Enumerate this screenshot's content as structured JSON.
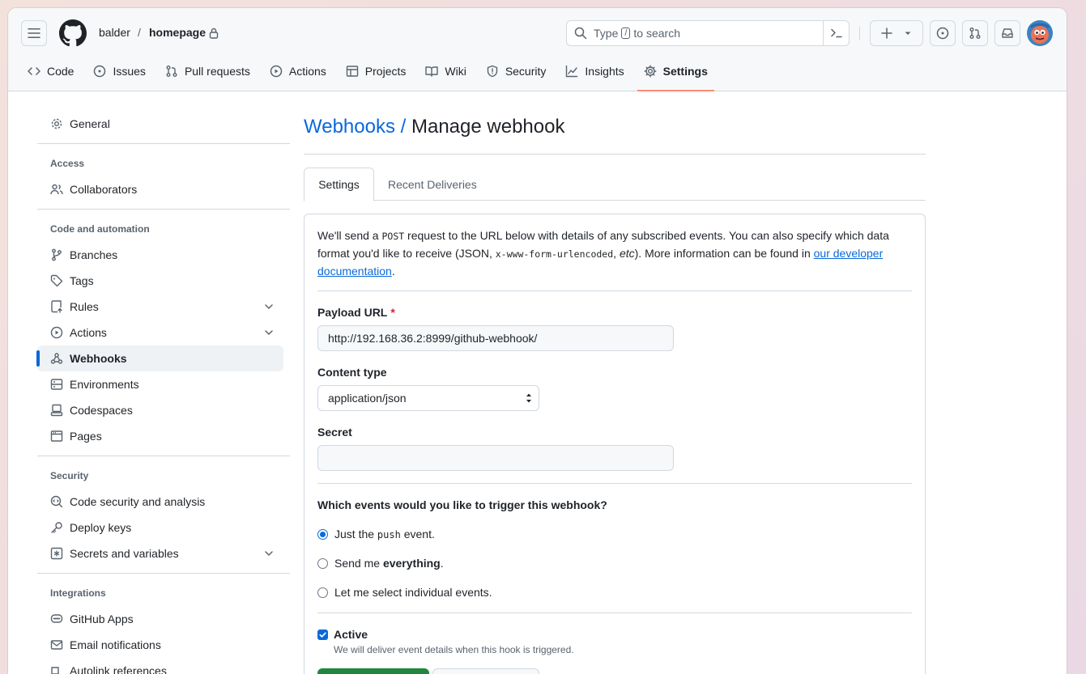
{
  "header": {
    "owner": "balder",
    "separator": "/",
    "repo": "homepage",
    "search": {
      "prefix": "Type",
      "key": "/",
      "suffix": "to search"
    }
  },
  "repo_nav": [
    {
      "label": "Code",
      "icon": "code-icon"
    },
    {
      "label": "Issues",
      "icon": "issue-opened-icon"
    },
    {
      "label": "Pull requests",
      "icon": "git-pull-request-icon"
    },
    {
      "label": "Actions",
      "icon": "play-icon"
    },
    {
      "label": "Projects",
      "icon": "table-icon"
    },
    {
      "label": "Wiki",
      "icon": "book-icon"
    },
    {
      "label": "Security",
      "icon": "shield-icon"
    },
    {
      "label": "Insights",
      "icon": "graph-icon"
    },
    {
      "label": "Settings",
      "icon": "gear-icon",
      "active": true
    }
  ],
  "sidebar": {
    "general": "General",
    "access_heading": "Access",
    "collaborators": "Collaborators",
    "code_heading": "Code and automation",
    "branches": "Branches",
    "tags": "Tags",
    "rules": "Rules",
    "actions": "Actions",
    "webhooks": "Webhooks",
    "environments": "Environments",
    "codespaces": "Codespaces",
    "pages": "Pages",
    "security_heading": "Security",
    "code_security": "Code security and analysis",
    "deploy_keys": "Deploy keys",
    "secrets": "Secrets and variables",
    "integrations_heading": "Integrations",
    "github_apps": "GitHub Apps",
    "email_notifications": "Email notifications",
    "autolink": "Autolink references"
  },
  "main": {
    "title_link": "Webhooks",
    "title_sep": "/",
    "title": "Manage webhook",
    "tabs": [
      "Settings",
      "Recent Deliveries"
    ],
    "intro": {
      "p1": "We'll send a ",
      "post": "POST",
      "p2": " request to the URL below with details of any subscribed events. You can also specify which data format you'd like to receive (JSON, ",
      "form": "x-www-form-urlencoded",
      "p3": ", ",
      "etc": "etc",
      "p4": "). More information can be found in ",
      "link": "our developer documentation",
      "p5": "."
    },
    "payload_label": "Payload URL",
    "payload_required": "*",
    "payload_value": "http://192.168.36.2:8999/github-webhook/",
    "content_type_label": "Content type",
    "content_type_value": "application/json",
    "secret_label": "Secret",
    "secret_value": "",
    "events_label": "Which events would you like to trigger this webhook?",
    "events": {
      "push_pre": "Just the",
      "push_code": "push",
      "push_post": "event.",
      "everything_pre": "Send me",
      "everything_bold": "everything",
      "everything_post": ".",
      "individual": "Let me select individual events."
    },
    "active_label": "Active",
    "active_help": "We will deliver event details when this hook is triggered."
  },
  "colors": {
    "accent": "#0969da",
    "tab_underline": "#fd8c73",
    "primary_button": "#1f883d"
  }
}
